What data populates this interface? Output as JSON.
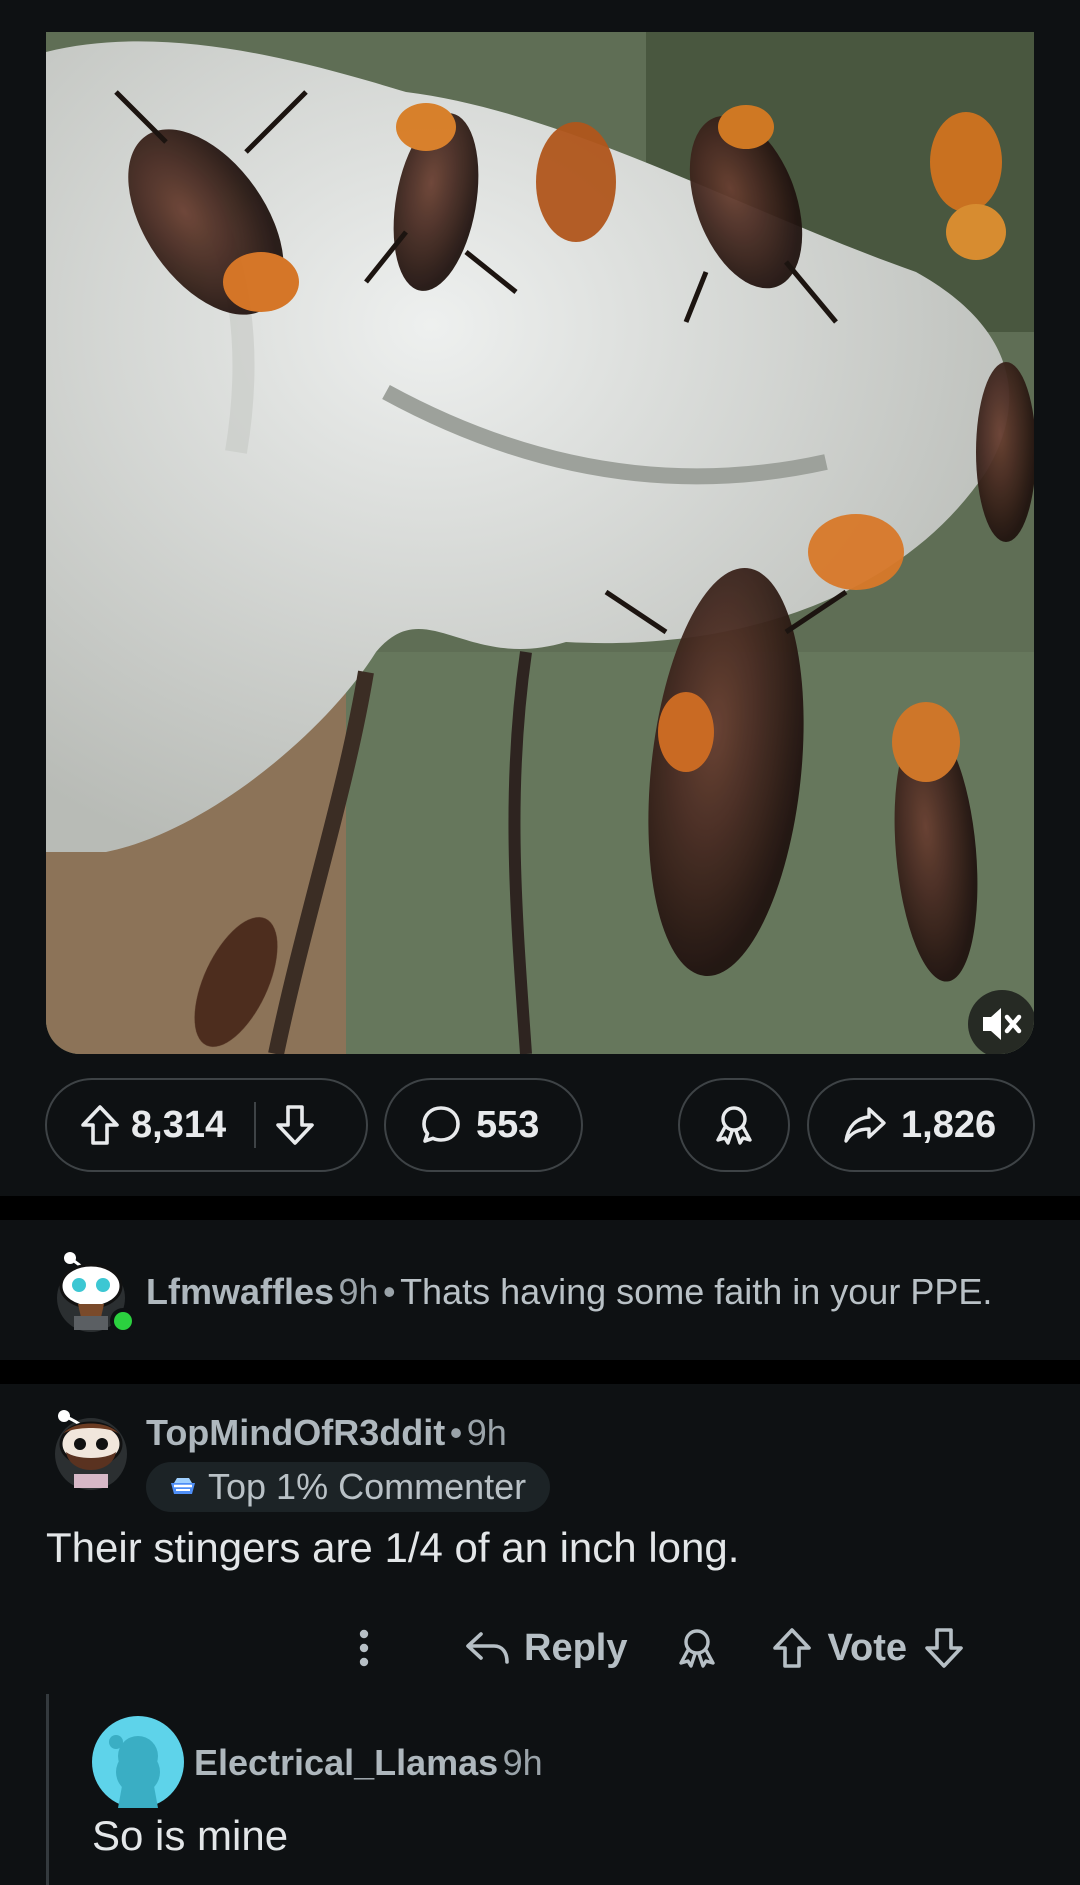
{
  "post": {
    "media": {
      "muted": true,
      "mute_icon": "speaker-muted-icon"
    },
    "actions": {
      "upvote_icon": "arrow-up-icon",
      "downvote_icon": "arrow-down-icon",
      "vote_count": "8,314",
      "comment_icon": "speech-bubble-icon",
      "comment_count": "553",
      "award_icon": "award-icon",
      "share_icon": "share-arrow-icon",
      "share_count": "1,826"
    }
  },
  "comments": [
    {
      "username": "Lfmwaffles",
      "time": "9h",
      "separator": "•",
      "text": "Thats having some faith in your PPE.",
      "online": true,
      "online_color": "#2bd13f"
    },
    {
      "username": "TopMindOfR3ddit",
      "separator": "•",
      "time": "9h",
      "flair": "Top 1% Commenter",
      "text": "Their stingers are 1/4 of an inch long.",
      "actions": {
        "more_icon": "more-vertical-icon",
        "reply": "Reply",
        "award_icon": "award-icon",
        "vote": "Vote"
      }
    },
    {
      "username": "Electrical_Llamas",
      "time": "9h",
      "text": "So is mine",
      "avatar_color": "#5ed3ea"
    }
  ]
}
